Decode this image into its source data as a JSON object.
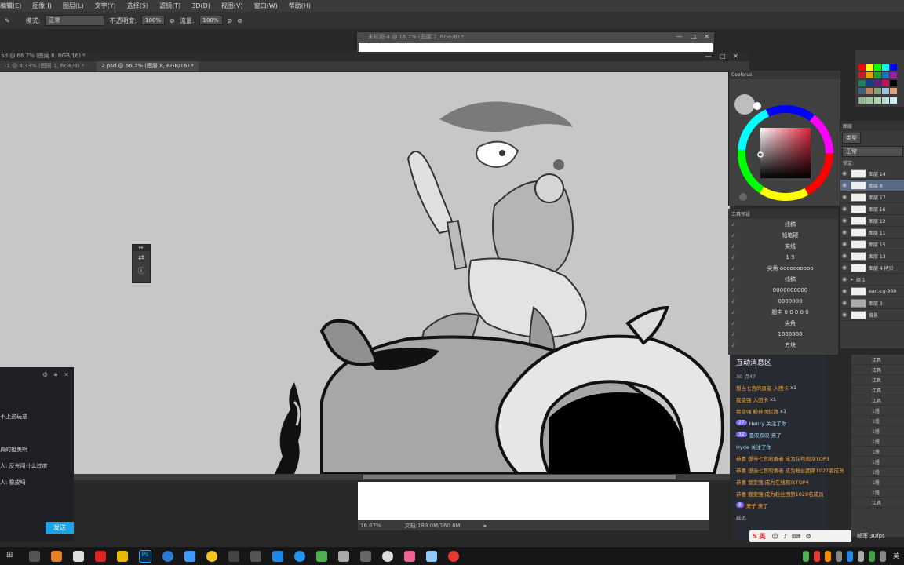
{
  "menubar": {
    "items": [
      "编辑(E)",
      "图像(I)",
      "图层(L)",
      "文字(Y)",
      "选择(S)",
      "滤镜(T)",
      "3D(D)",
      "视图(V)",
      "窗口(W)",
      "帮助(H)"
    ]
  },
  "options": {
    "mode_label": "模式:",
    "mode_value": "正常",
    "opacity_label": "不透明度:",
    "opacity_value": "100%",
    "flow_label": "流量:",
    "flow_value": "100%"
  },
  "bg_window": {
    "title": "未标题-4 @ 16.7% (图层 2, RGB/8) *"
  },
  "doc": {
    "title": "sd @ 66.7% (图层 8, RGB/16) *",
    "tabs": [
      {
        "label": "-1 @ 8.33% (图层 1, RGB/8) *",
        "active": false
      },
      {
        "label": "2.psd @ 66.7% (图层 8, RGB/16) *",
        "active": true
      }
    ]
  },
  "status": {
    "zoom": "16.67%",
    "doc_info": "文档:183.0M/160.8M"
  },
  "coolorus": {
    "title": "Coolorus"
  },
  "presets": {
    "title": "工具预设",
    "items": [
      "线稿",
      "铅笔硬",
      "实线",
      "1 9",
      "尖角 oooooooooo",
      "线稿",
      "0000000000",
      "0000000",
      "腮丰 0 0 0 0 0",
      "尖角",
      "1888888",
      "方块"
    ]
  },
  "layers": {
    "title": "图层",
    "kind": "类型",
    "blend": "正常",
    "lock": "锁定:",
    "items": [
      {
        "name": "图层 14",
        "selected": false
      },
      {
        "name": "图层 8",
        "selected": true
      },
      {
        "name": "图层 17",
        "selected": false
      },
      {
        "name": "图层 16",
        "selected": false
      },
      {
        "name": "图层 12",
        "selected": false
      },
      {
        "name": "图层 11",
        "selected": false
      },
      {
        "name": "图层 15",
        "selected": false
      },
      {
        "name": "图层 13",
        "selected": false
      },
      {
        "name": "图层 4 拷贝",
        "selected": false
      },
      {
        "name": "组 1",
        "selected": false
      },
      {
        "name": "eart-cg-960",
        "selected": false
      },
      {
        "name": "图层 3",
        "selected": false
      },
      {
        "name": "背景",
        "selected": false
      }
    ]
  },
  "chat_left": {
    "messages": [
      "不上这玩意",
      "真的挺美啊",
      "人: 反光用什么过度",
      "人: 橡皮吗"
    ],
    "send_label": "发送"
  },
  "interaction": {
    "title": "互动消息区",
    "stats": "30  点47",
    "lines": [
      {
        "text": "想当七宫的勇者 入团卡",
        "suffix": "x1",
        "badge": ""
      },
      {
        "text": "我变强 入团卡",
        "suffix": "x1",
        "badge": ""
      },
      {
        "text": "我变强 粉丝团灯牌",
        "suffix": "x1",
        "badge": ""
      },
      {
        "text": "Henry 关注了你",
        "suffix": "",
        "badge": "27"
      },
      {
        "text": "是叹叹叹 来了",
        "suffix": "",
        "badge": "32"
      },
      {
        "text": "Hyde 关注了你",
        "suffix": "",
        "badge": ""
      },
      {
        "text": "恭喜 想当七宫的勇者 成为在线观众TOP3",
        "suffix": "",
        "badge": ""
      },
      {
        "text": "恭喜 想当七宫的勇者 成为粉丝团第1027名成员",
        "suffix": "",
        "badge": ""
      },
      {
        "text": "恭喜 我变强 成为在线观众TOP4",
        "suffix": "",
        "badge": ""
      },
      {
        "text": "恭喜 我变强 成为粉丝团第1028名成员",
        "suffix": "",
        "badge": ""
      },
      {
        "text": "来子 来了",
        "suffix": "",
        "badge": "8"
      }
    ],
    "footer_left": "延迟",
    "footer_right": "帧率 30fps"
  },
  "history": {
    "items": [
      "江具",
      "江具",
      "江具",
      "江具",
      "江具",
      "1撸",
      "1撸",
      "1撸",
      "1撸",
      "1撸",
      "1撸",
      "1撸",
      "1撸",
      "1撸",
      "江具"
    ]
  },
  "ime": {
    "label": "S 英"
  },
  "tray": {
    "lang": "英"
  }
}
